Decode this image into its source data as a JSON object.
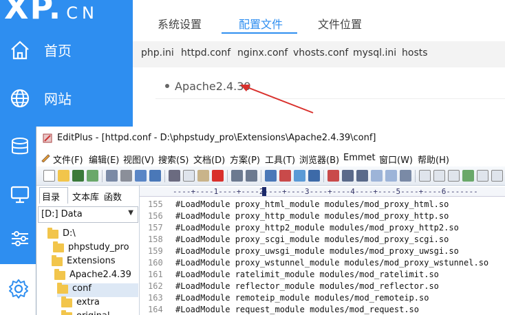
{
  "phpstudy": {
    "logo": "XP.",
    "logo_suffix": "CN",
    "nav": [
      {
        "label": "首页",
        "icon": "home-icon"
      },
      {
        "label": "网站",
        "icon": "globe-icon"
      },
      {
        "label": "",
        "icon": "database-icon"
      },
      {
        "label": "",
        "icon": "monitor-icon"
      },
      {
        "label": "",
        "icon": "sliders-icon"
      },
      {
        "label": "",
        "icon": "gear-icon"
      }
    ],
    "top_tabs": [
      "系统设置",
      "配置文件",
      "文件位置"
    ],
    "active_top_tab": "配置文件",
    "sub_tabs": [
      "php.ini",
      "httpd.conf",
      "nginx.conf",
      "vhosts.conf",
      "mysql.ini",
      "hosts"
    ],
    "active_sub_tab": "httpd.conf",
    "apache_item": "Apache2.4.39",
    "arrow_color": "#d9302c",
    "accent": "#2e8ef0"
  },
  "editplus": {
    "title": "EditPlus - [httpd.conf - D:\\phpstudy_pro\\Extensions\\Apache2.4.39\\conf]",
    "menu": [
      "文件(F)",
      "编辑(E)",
      "视图(V)",
      "搜索(S)",
      "文档(D)",
      "方案(P)",
      "工具(T)",
      "浏览器(B)",
      "Emmet",
      "窗口(W)",
      "帮助(H)"
    ],
    "side_tabs": [
      "目录",
      "文本库",
      "函数"
    ],
    "active_side_tab": "目录",
    "drive": "[D:] Data",
    "tree": [
      {
        "label": "D:\\",
        "depth": 0
      },
      {
        "label": "phpstudy_pro",
        "depth": 1
      },
      {
        "label": "Extensions",
        "depth": 2
      },
      {
        "label": "Apache2.4.39",
        "depth": 3
      },
      {
        "label": "conf",
        "depth": 4,
        "selected": true
      },
      {
        "label": "extra",
        "depth": 5
      },
      {
        "label": "original",
        "depth": 5
      }
    ],
    "ruler": "----+----1----+----2----+----3----+----4----+----5----+----6-------",
    "lines": [
      {
        "n": "155",
        "text": "#LoadModule proxy_html_module modules/mod_proxy_html.so"
      },
      {
        "n": "156",
        "text": "#LoadModule proxy_http_module modules/mod_proxy_http.so"
      },
      {
        "n": "157",
        "text": "#LoadModule proxy_http2_module modules/mod_proxy_http2.so"
      },
      {
        "n": "158",
        "text": "#LoadModule proxy_scgi_module modules/mod_proxy_scgi.so"
      },
      {
        "n": "159",
        "text": "#LoadModule proxy_uwsgi_module modules/mod_proxy_uwsgi.so"
      },
      {
        "n": "160",
        "text": "#LoadModule proxy_wstunnel_module modules/mod_proxy_wstunnel.so"
      },
      {
        "n": "161",
        "text": "#LoadModule ratelimit_module modules/mod_ratelimit.so"
      },
      {
        "n": "162",
        "text": "#LoadModule reflector_module modules/mod_reflector.so"
      },
      {
        "n": "163",
        "text": "#LoadModule remoteip_module modules/mod_remoteip.so"
      },
      {
        "n": "164",
        "text": "#LoadModule request_module modules/mod_request.so"
      }
    ]
  }
}
